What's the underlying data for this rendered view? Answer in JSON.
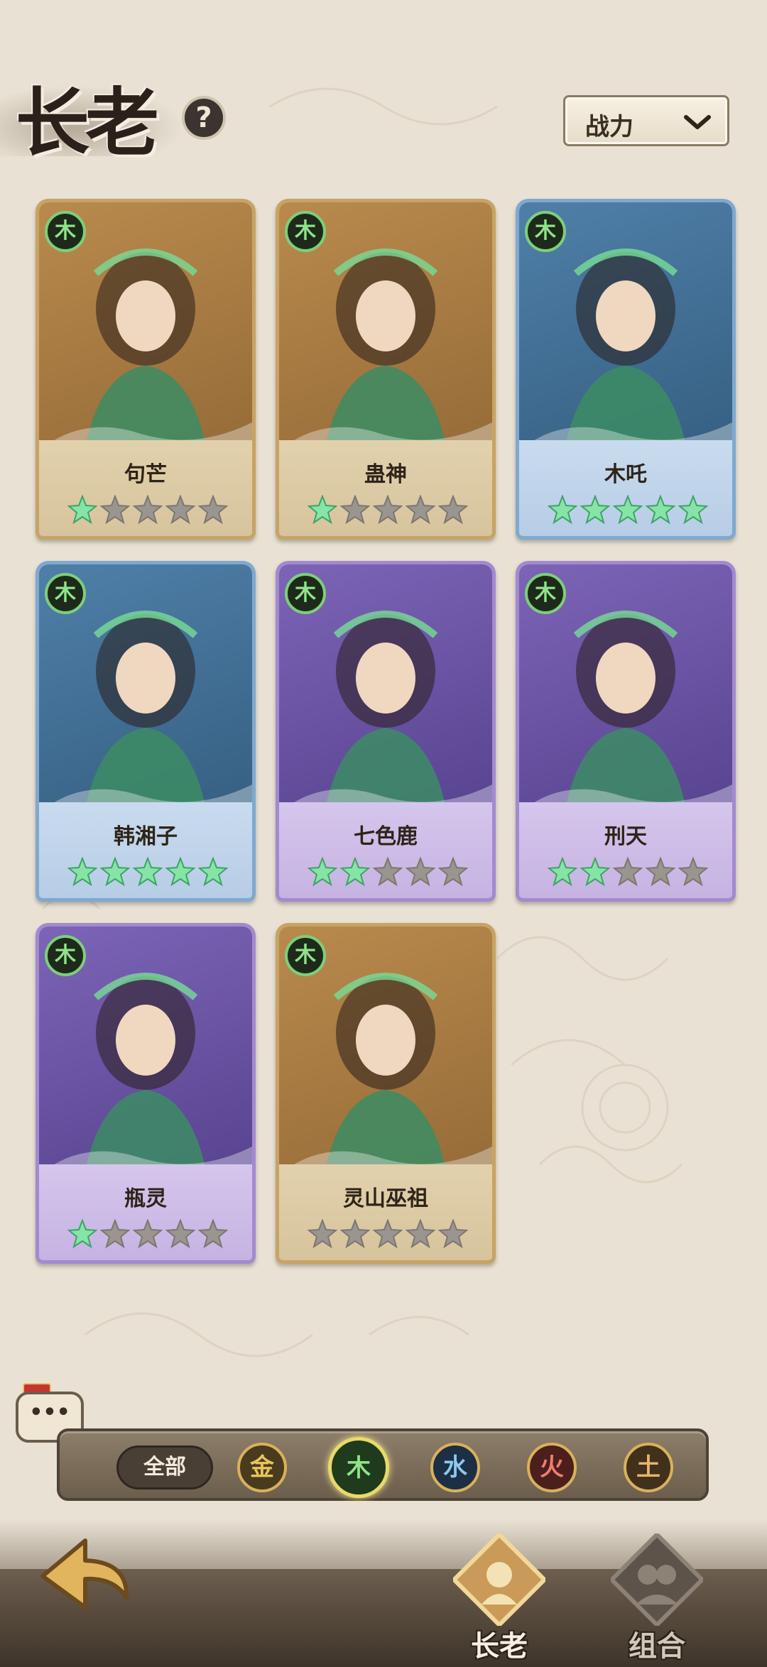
{
  "header": {
    "title": "长老",
    "help_label": "?",
    "sort": {
      "selected": "战力"
    }
  },
  "cards": [
    {
      "name": "句芒",
      "element": "木",
      "frame": "gold",
      "stars_filled": 1,
      "stars_total": 5
    },
    {
      "name": "蛊神",
      "element": "木",
      "frame": "gold",
      "stars_filled": 1,
      "stars_total": 5
    },
    {
      "name": "木吒",
      "element": "木",
      "frame": "blue",
      "stars_filled": 5,
      "stars_total": 5
    },
    {
      "name": "韩湘子",
      "element": "木",
      "frame": "blue",
      "stars_filled": 5,
      "stars_total": 5
    },
    {
      "name": "七色鹿",
      "element": "木",
      "frame": "purple",
      "stars_filled": 2,
      "stars_total": 5
    },
    {
      "name": "刑天",
      "element": "木",
      "frame": "purple",
      "stars_filled": 2,
      "stars_total": 5
    },
    {
      "name": "瓶灵",
      "element": "木",
      "frame": "purple",
      "stars_filled": 1,
      "stars_total": 5
    },
    {
      "name": "灵山巫祖",
      "element": "木",
      "frame": "gold",
      "stars_filled": 0,
      "stars_total": 5
    }
  ],
  "filter": {
    "all_label": "全部",
    "elements": [
      {
        "label": "金",
        "color": "#e7c45c",
        "bg": "#4a3a1e",
        "selected": false
      },
      {
        "label": "木",
        "color": "#8fe388",
        "bg": "#1f3a1c",
        "selected": true
      },
      {
        "label": "水",
        "color": "#8fc8f0",
        "bg": "#1c2f44",
        "selected": false
      },
      {
        "label": "火",
        "color": "#f07c6c",
        "bg": "#4a1f1c",
        "selected": false
      },
      {
        "label": "土",
        "color": "#e8b36c",
        "bg": "#40301c",
        "selected": false
      }
    ]
  },
  "chat": {
    "label": "•••"
  },
  "nav": {
    "tabs": [
      {
        "label": "长老",
        "active": true
      },
      {
        "label": "组合",
        "active": false
      }
    ]
  },
  "colors": {
    "star_on": "#86e4a6",
    "star_off": "#9b9590"
  }
}
